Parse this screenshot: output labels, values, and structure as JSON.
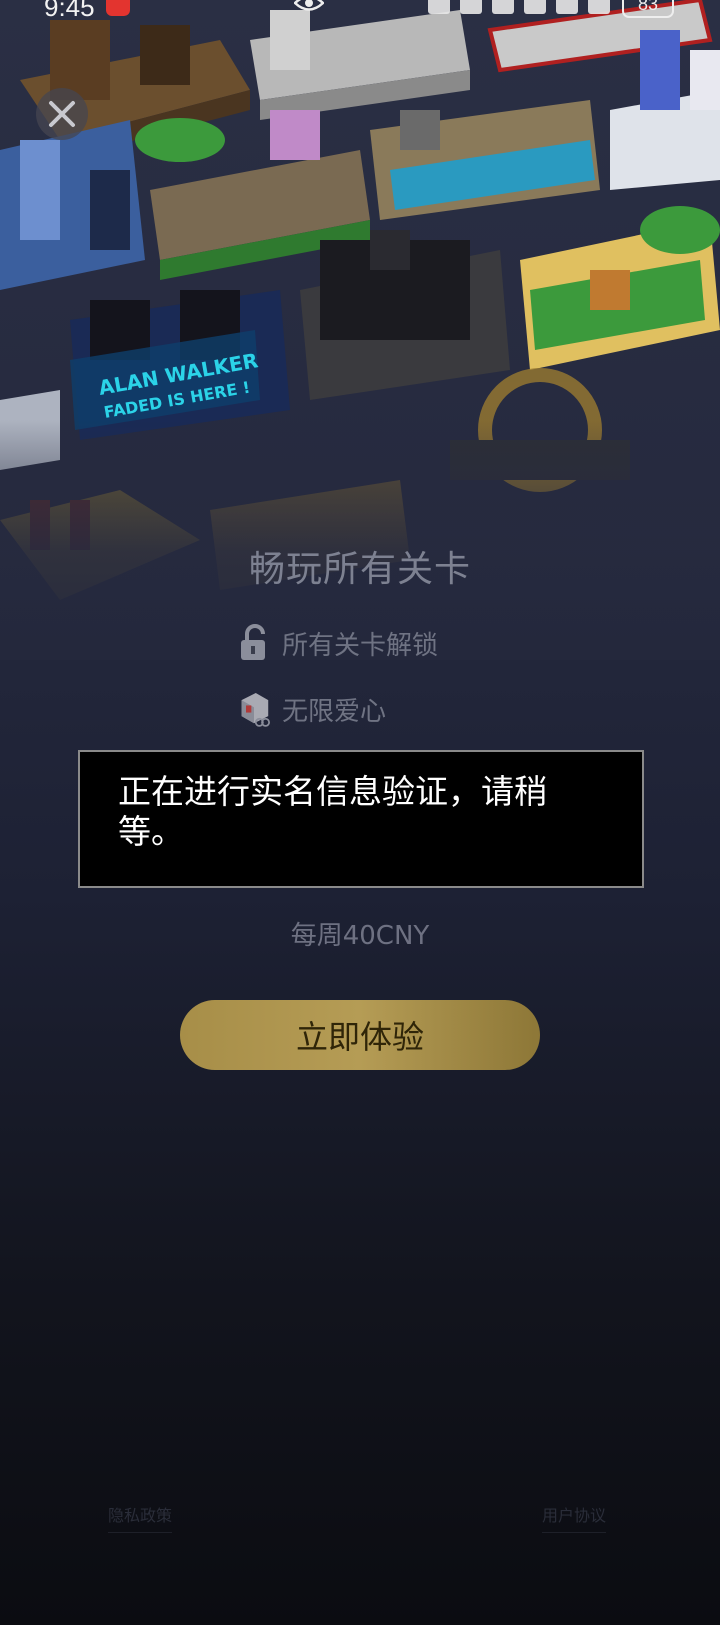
{
  "status_bar": {
    "time": "9:45",
    "battery": "83"
  },
  "promo": {
    "title": "畅玩所有关卡",
    "features": [
      {
        "label": "所有关卡解锁",
        "icon": "padlock-icon"
      },
      {
        "label": "无限爱心",
        "icon": "heart-cube-icon"
      }
    ],
    "price": "每周40CNY",
    "cta_label": "立即体验"
  },
  "footer": {
    "privacy_label": "隐私政策",
    "terms_label": "用户协议"
  },
  "toast": {
    "message": "正在进行实名信息验证，请稍等。"
  },
  "art": {
    "level_banner_line1": "ALAN WALKER",
    "level_banner_line2": "FADED IS HERE !"
  },
  "colors": {
    "toast_bg": "#000000",
    "cta_gold": "#b59c55",
    "background_top": "#2a2f44",
    "background_bottom": "#0b0c11"
  }
}
